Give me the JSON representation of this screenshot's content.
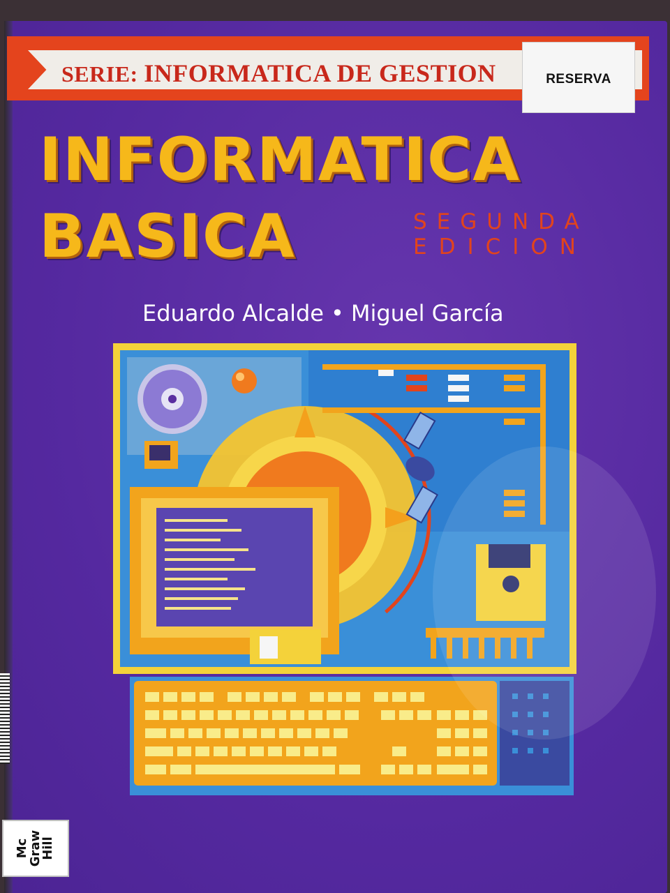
{
  "series": {
    "prefix": "SERIE:",
    "name": "INFORMATICA DE GESTION"
  },
  "label": {
    "text": "RESERVA"
  },
  "title": {
    "line1": "INFORMATICA",
    "line2": "BASICA"
  },
  "edition": {
    "line1": "SEGUNDA",
    "line2": "EDICION"
  },
  "authors": {
    "first": "Eduardo Alcalde",
    "separator": "•",
    "second": "Miguel García"
  },
  "publisher": {
    "line1": "Mc",
    "line2": "Graw",
    "line3": "Hill"
  },
  "colors": {
    "cover": "#5a2fa0",
    "title": "#f6b81a",
    "accent_red": "#e2441c",
    "illustration_blue": "#3a8fd8",
    "illustration_orange": "#f2a41c"
  },
  "icons": [
    "cd-disc-icon",
    "floppy-disk-icon",
    "satellite-icon",
    "abacus-icon",
    "computer-monitor-icon",
    "keyboard-icon",
    "sun-icon",
    "chip-icon"
  ]
}
